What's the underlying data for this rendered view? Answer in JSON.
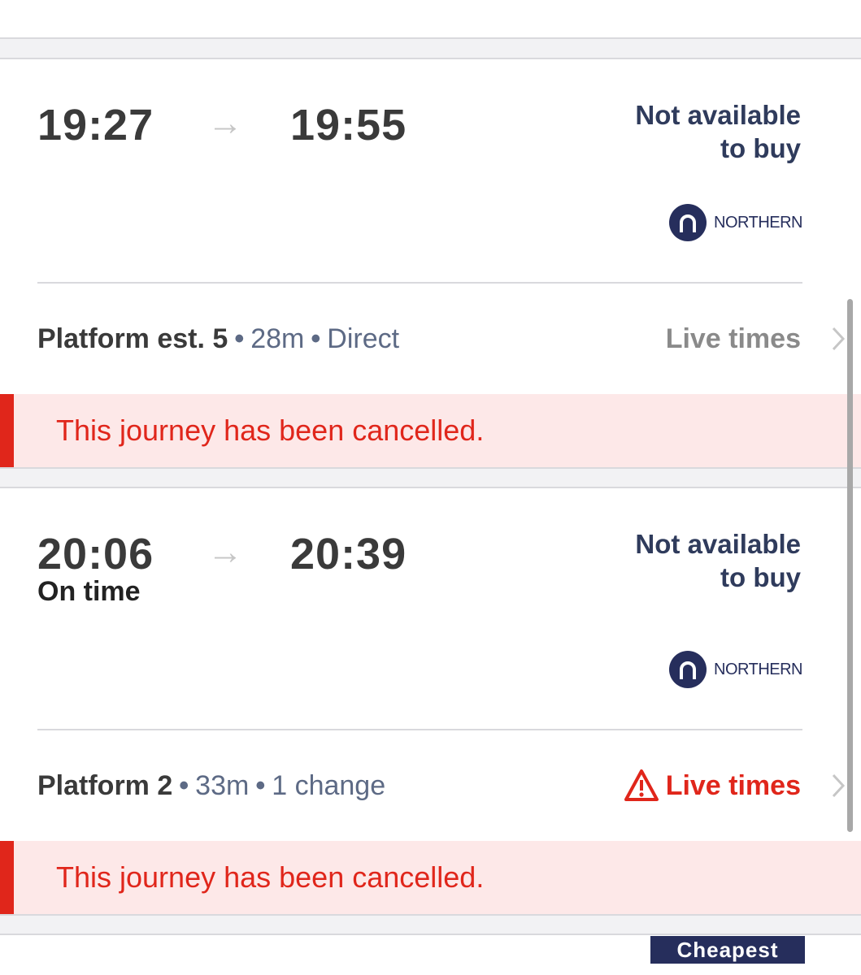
{
  "journeys": [
    {
      "depart": "19:27",
      "arrive": "19:55",
      "depart_status": "",
      "availability_line1": "Not available",
      "availability_line2": "to buy",
      "operator": "NORTHERN",
      "platform": "Platform est. 5",
      "duration": "28m",
      "changes": "Direct",
      "live_times": "Live times",
      "live_times_alert": false,
      "cancel_message": "This journey has been cancelled."
    },
    {
      "depart": "20:06",
      "arrive": "20:39",
      "depart_status": "On time",
      "availability_line1": "Not available",
      "availability_line2": "to buy",
      "operator": "NORTHERN",
      "platform": "Platform 2",
      "duration": "33m",
      "changes": "1 change",
      "live_times": "Live times",
      "live_times_alert": true,
      "cancel_message": "This journey has been cancelled."
    }
  ],
  "next_card": {
    "badge": "Cheapest"
  },
  "colors": {
    "cancel_red": "#e0261b",
    "cancel_bg": "#fde8e8",
    "navy": "#262e5c",
    "meta_blue": "#5d6a85"
  },
  "icons": {
    "arrow": "arrow-right-icon",
    "operator_logo": "northern-logo-icon",
    "warning": "warning-triangle-icon",
    "chevron": "chevron-right-icon"
  }
}
